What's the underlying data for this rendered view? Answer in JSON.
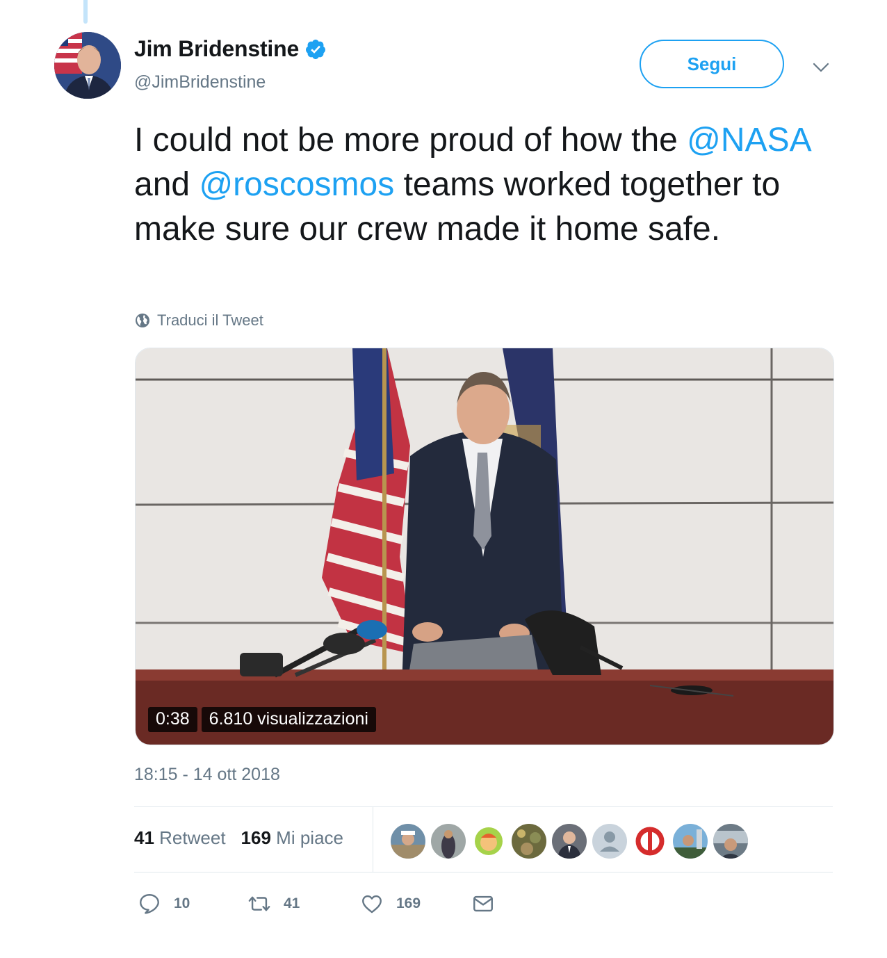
{
  "author": {
    "name": "Jim Bridenstine",
    "handle": "@JimBridenstine",
    "verified": true
  },
  "follow_button": {
    "label": "Segui"
  },
  "tweet": {
    "text_before": "I could not be more proud of how the",
    "mention_1": "@NASA",
    "text_middle": "and",
    "mention_2": "@roscosmos",
    "text_after": "teams worked together to make sure our crew made it home safe."
  },
  "translate": {
    "label": "Traduci il Tweet"
  },
  "video": {
    "duration": "0:38",
    "views": "6.810 visualizzazioni"
  },
  "timestamp": "18:15 - 14 ott 2018",
  "stats": {
    "retweets_count": "41",
    "retweets_label": "Retweet",
    "likes_count": "169",
    "likes_label": "Mi piace"
  },
  "actions": {
    "reply_count": "10",
    "retweet_count": "41",
    "like_count": "169"
  },
  "colors": {
    "accent": "#1da1f2",
    "secondary_text": "#657786",
    "primary_text": "#14171a"
  }
}
